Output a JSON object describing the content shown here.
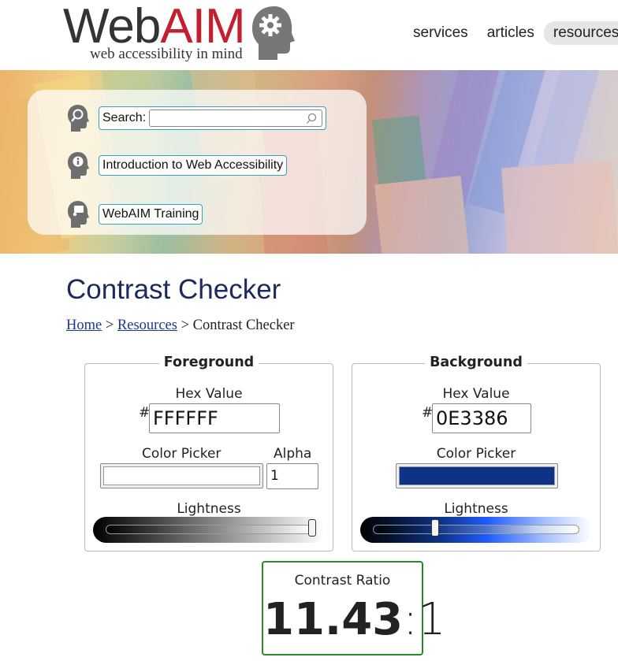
{
  "logo": {
    "web": "Web",
    "aim": "AIM",
    "tagline": "web accessibility in mind"
  },
  "nav": {
    "items": [
      {
        "label": "services"
      },
      {
        "label": "articles"
      },
      {
        "label": "resources"
      }
    ]
  },
  "quick_links": {
    "search_label": "Search:",
    "search_value": "",
    "intro_link": "Introduction to Web Accessibility",
    "training_link": "WebAIM Training"
  },
  "page": {
    "title": "Contrast Checker"
  },
  "breadcrumb": {
    "home": "Home",
    "sep1": " > ",
    "resources": "Resources",
    "sep2": " > ",
    "current": "Contrast Checker"
  },
  "foreground": {
    "legend": "Foreground",
    "hex_label": "Hex Value",
    "hash": "#",
    "hex_value": "FFFFFF",
    "picker_label": "Color Picker",
    "alpha_label": "Alpha",
    "alpha_value": "1",
    "lightness_label": "Lightness",
    "swatch_color": "#ffffff",
    "lightness_level": 1.0
  },
  "background": {
    "legend": "Background",
    "hex_label": "Hex Value",
    "hash": "#",
    "hex_value": "0E3386",
    "picker_label": "Color Picker",
    "lightness_label": "Lightness",
    "swatch_color": "#0e3386",
    "lightness_level": 0.3
  },
  "contrast": {
    "label": "Contrast Ratio",
    "value_main": "11.43",
    "value_rest": ":1",
    "pass_color": "#2a8a2a"
  },
  "colors": {
    "brand_red": "#c41e2f",
    "title_navy": "#1c2a5c",
    "link_blue": "#1b3a8f"
  }
}
